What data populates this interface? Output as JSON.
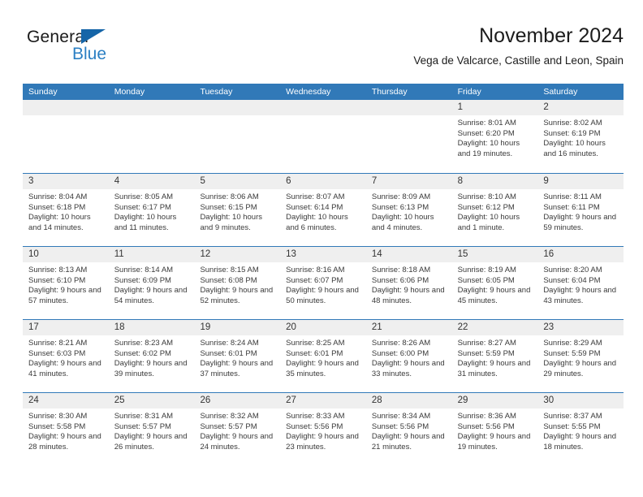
{
  "brand": {
    "name_part1": "General",
    "name_part2": "Blue",
    "triangle_icon": "triangle-icon",
    "accent_blue": "#2b7fc3",
    "logo_dark": "#1a1a1a"
  },
  "header": {
    "title": "November 2024",
    "subtitle": "Vega de Valcarce, Castille and Leon, Spain"
  },
  "theme": {
    "header_bg": "#3179b8",
    "header_text": "#ffffff",
    "day_band_bg": "#efefef",
    "grid_line": "#3179b8",
    "body_text": "#3a3a3a"
  },
  "weekdays": [
    "Sunday",
    "Monday",
    "Tuesday",
    "Wednesday",
    "Thursday",
    "Friday",
    "Saturday"
  ],
  "weeks": [
    [
      {
        "day": "",
        "empty": true
      },
      {
        "day": "",
        "empty": true
      },
      {
        "day": "",
        "empty": true
      },
      {
        "day": "",
        "empty": true
      },
      {
        "day": "",
        "empty": true
      },
      {
        "day": "1",
        "sunrise": "Sunrise: 8:01 AM",
        "sunset": "Sunset: 6:20 PM",
        "daylight": "Daylight: 10 hours and 19 minutes."
      },
      {
        "day": "2",
        "sunrise": "Sunrise: 8:02 AM",
        "sunset": "Sunset: 6:19 PM",
        "daylight": "Daylight: 10 hours and 16 minutes."
      }
    ],
    [
      {
        "day": "3",
        "sunrise": "Sunrise: 8:04 AM",
        "sunset": "Sunset: 6:18 PM",
        "daylight": "Daylight: 10 hours and 14 minutes."
      },
      {
        "day": "4",
        "sunrise": "Sunrise: 8:05 AM",
        "sunset": "Sunset: 6:17 PM",
        "daylight": "Daylight: 10 hours and 11 minutes."
      },
      {
        "day": "5",
        "sunrise": "Sunrise: 8:06 AM",
        "sunset": "Sunset: 6:15 PM",
        "daylight": "Daylight: 10 hours and 9 minutes."
      },
      {
        "day": "6",
        "sunrise": "Sunrise: 8:07 AM",
        "sunset": "Sunset: 6:14 PM",
        "daylight": "Daylight: 10 hours and 6 minutes."
      },
      {
        "day": "7",
        "sunrise": "Sunrise: 8:09 AM",
        "sunset": "Sunset: 6:13 PM",
        "daylight": "Daylight: 10 hours and 4 minutes."
      },
      {
        "day": "8",
        "sunrise": "Sunrise: 8:10 AM",
        "sunset": "Sunset: 6:12 PM",
        "daylight": "Daylight: 10 hours and 1 minute."
      },
      {
        "day": "9",
        "sunrise": "Sunrise: 8:11 AM",
        "sunset": "Sunset: 6:11 PM",
        "daylight": "Daylight: 9 hours and 59 minutes."
      }
    ],
    [
      {
        "day": "10",
        "sunrise": "Sunrise: 8:13 AM",
        "sunset": "Sunset: 6:10 PM",
        "daylight": "Daylight: 9 hours and 57 minutes."
      },
      {
        "day": "11",
        "sunrise": "Sunrise: 8:14 AM",
        "sunset": "Sunset: 6:09 PM",
        "daylight": "Daylight: 9 hours and 54 minutes."
      },
      {
        "day": "12",
        "sunrise": "Sunrise: 8:15 AM",
        "sunset": "Sunset: 6:08 PM",
        "daylight": "Daylight: 9 hours and 52 minutes."
      },
      {
        "day": "13",
        "sunrise": "Sunrise: 8:16 AM",
        "sunset": "Sunset: 6:07 PM",
        "daylight": "Daylight: 9 hours and 50 minutes."
      },
      {
        "day": "14",
        "sunrise": "Sunrise: 8:18 AM",
        "sunset": "Sunset: 6:06 PM",
        "daylight": "Daylight: 9 hours and 48 minutes."
      },
      {
        "day": "15",
        "sunrise": "Sunrise: 8:19 AM",
        "sunset": "Sunset: 6:05 PM",
        "daylight": "Daylight: 9 hours and 45 minutes."
      },
      {
        "day": "16",
        "sunrise": "Sunrise: 8:20 AM",
        "sunset": "Sunset: 6:04 PM",
        "daylight": "Daylight: 9 hours and 43 minutes."
      }
    ],
    [
      {
        "day": "17",
        "sunrise": "Sunrise: 8:21 AM",
        "sunset": "Sunset: 6:03 PM",
        "daylight": "Daylight: 9 hours and 41 minutes."
      },
      {
        "day": "18",
        "sunrise": "Sunrise: 8:23 AM",
        "sunset": "Sunset: 6:02 PM",
        "daylight": "Daylight: 9 hours and 39 minutes."
      },
      {
        "day": "19",
        "sunrise": "Sunrise: 8:24 AM",
        "sunset": "Sunset: 6:01 PM",
        "daylight": "Daylight: 9 hours and 37 minutes."
      },
      {
        "day": "20",
        "sunrise": "Sunrise: 8:25 AM",
        "sunset": "Sunset: 6:01 PM",
        "daylight": "Daylight: 9 hours and 35 minutes."
      },
      {
        "day": "21",
        "sunrise": "Sunrise: 8:26 AM",
        "sunset": "Sunset: 6:00 PM",
        "daylight": "Daylight: 9 hours and 33 minutes."
      },
      {
        "day": "22",
        "sunrise": "Sunrise: 8:27 AM",
        "sunset": "Sunset: 5:59 PM",
        "daylight": "Daylight: 9 hours and 31 minutes."
      },
      {
        "day": "23",
        "sunrise": "Sunrise: 8:29 AM",
        "sunset": "Sunset: 5:59 PM",
        "daylight": "Daylight: 9 hours and 29 minutes."
      }
    ],
    [
      {
        "day": "24",
        "sunrise": "Sunrise: 8:30 AM",
        "sunset": "Sunset: 5:58 PM",
        "daylight": "Daylight: 9 hours and 28 minutes."
      },
      {
        "day": "25",
        "sunrise": "Sunrise: 8:31 AM",
        "sunset": "Sunset: 5:57 PM",
        "daylight": "Daylight: 9 hours and 26 minutes."
      },
      {
        "day": "26",
        "sunrise": "Sunrise: 8:32 AM",
        "sunset": "Sunset: 5:57 PM",
        "daylight": "Daylight: 9 hours and 24 minutes."
      },
      {
        "day": "27",
        "sunrise": "Sunrise: 8:33 AM",
        "sunset": "Sunset: 5:56 PM",
        "daylight": "Daylight: 9 hours and 23 minutes."
      },
      {
        "day": "28",
        "sunrise": "Sunrise: 8:34 AM",
        "sunset": "Sunset: 5:56 PM",
        "daylight": "Daylight: 9 hours and 21 minutes."
      },
      {
        "day": "29",
        "sunrise": "Sunrise: 8:36 AM",
        "sunset": "Sunset: 5:56 PM",
        "daylight": "Daylight: 9 hours and 19 minutes."
      },
      {
        "day": "30",
        "sunrise": "Sunrise: 8:37 AM",
        "sunset": "Sunset: 5:55 PM",
        "daylight": "Daylight: 9 hours and 18 minutes."
      }
    ]
  ]
}
